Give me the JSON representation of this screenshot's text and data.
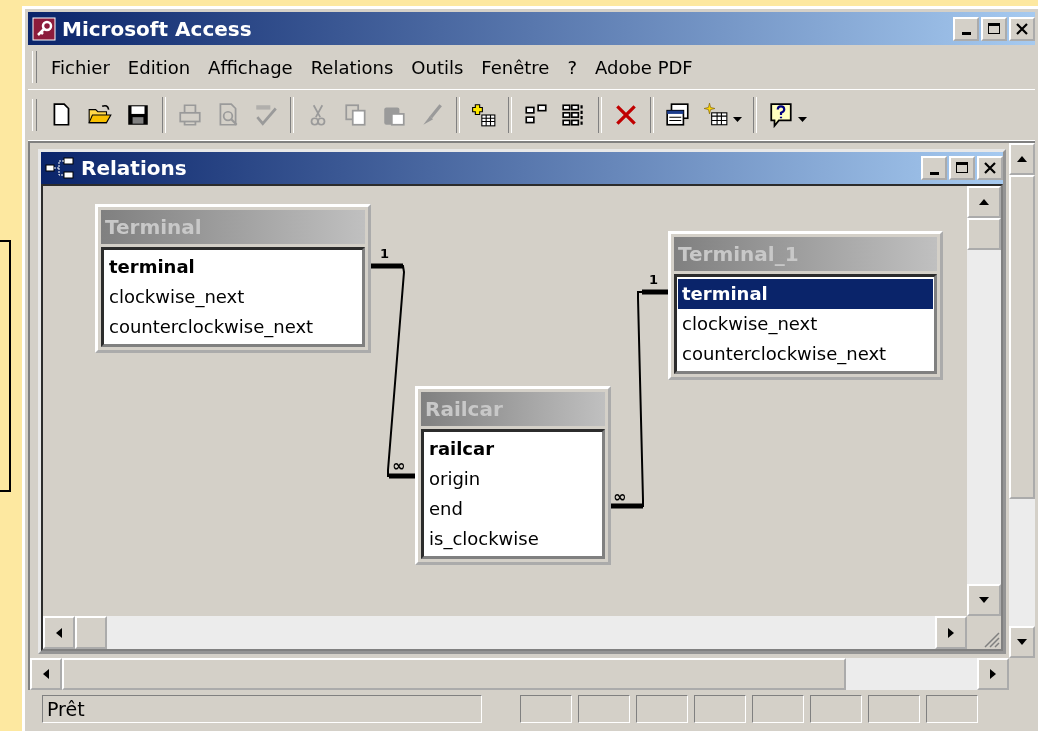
{
  "window": {
    "title": "Microsoft Access"
  },
  "menu": [
    {
      "label": "Fichier"
    },
    {
      "label": "Edition"
    },
    {
      "label": "Affichage"
    },
    {
      "label": "Relations"
    },
    {
      "label": "Outils"
    },
    {
      "label": "Fenêtre"
    },
    {
      "label": "?"
    },
    {
      "label": "Adobe PDF"
    }
  ],
  "toolbar": {
    "groups": [
      [
        {
          "kind": "new",
          "disabled": false
        },
        {
          "kind": "open",
          "disabled": false
        },
        {
          "kind": "save",
          "disabled": false
        }
      ],
      [
        {
          "kind": "print",
          "disabled": true
        },
        {
          "kind": "preview",
          "disabled": true
        },
        {
          "kind": "spelling",
          "disabled": true
        }
      ],
      [
        {
          "kind": "cut",
          "disabled": true
        },
        {
          "kind": "copy",
          "disabled": true
        },
        {
          "kind": "paste",
          "disabled": true
        },
        {
          "kind": "painter",
          "disabled": true
        }
      ],
      [
        {
          "kind": "add-table",
          "disabled": false
        }
      ],
      [
        {
          "kind": "direct",
          "disabled": false
        },
        {
          "kind": "all",
          "disabled": false
        }
      ],
      [
        {
          "kind": "delete",
          "disabled": false
        }
      ],
      [
        {
          "kind": "window",
          "disabled": false
        },
        {
          "kind": "new-object",
          "disabled": false
        }
      ],
      [
        {
          "kind": "help",
          "disabled": false
        }
      ]
    ]
  },
  "relations_window": {
    "title": "Relations",
    "tables": [
      {
        "title": "Terminal",
        "fields": [
          {
            "name": "terminal",
            "key": true,
            "selected": false
          },
          {
            "name": "clockwise_next",
            "key": false,
            "selected": false
          },
          {
            "name": "counterclockwise_next",
            "key": false,
            "selected": false
          }
        ]
      },
      {
        "title": "Terminal_1",
        "fields": [
          {
            "name": "terminal",
            "key": true,
            "selected": true
          },
          {
            "name": "clockwise_next",
            "key": false,
            "selected": false
          },
          {
            "name": "counterclockwise_next",
            "key": false,
            "selected": false
          }
        ]
      },
      {
        "title": "Railcar",
        "fields": [
          {
            "name": "railcar",
            "key": true,
            "selected": false
          },
          {
            "name": "origin",
            "key": false,
            "selected": false
          },
          {
            "name": "end",
            "key": false,
            "selected": false
          },
          {
            "name": "is_clockwise",
            "key": false,
            "selected": false
          }
        ]
      }
    ],
    "relationships": [
      {
        "one_label": "1",
        "many_label": "∞"
      },
      {
        "one_label": "1",
        "many_label": "∞"
      }
    ]
  },
  "status_bar": {
    "text": "Prêt"
  }
}
